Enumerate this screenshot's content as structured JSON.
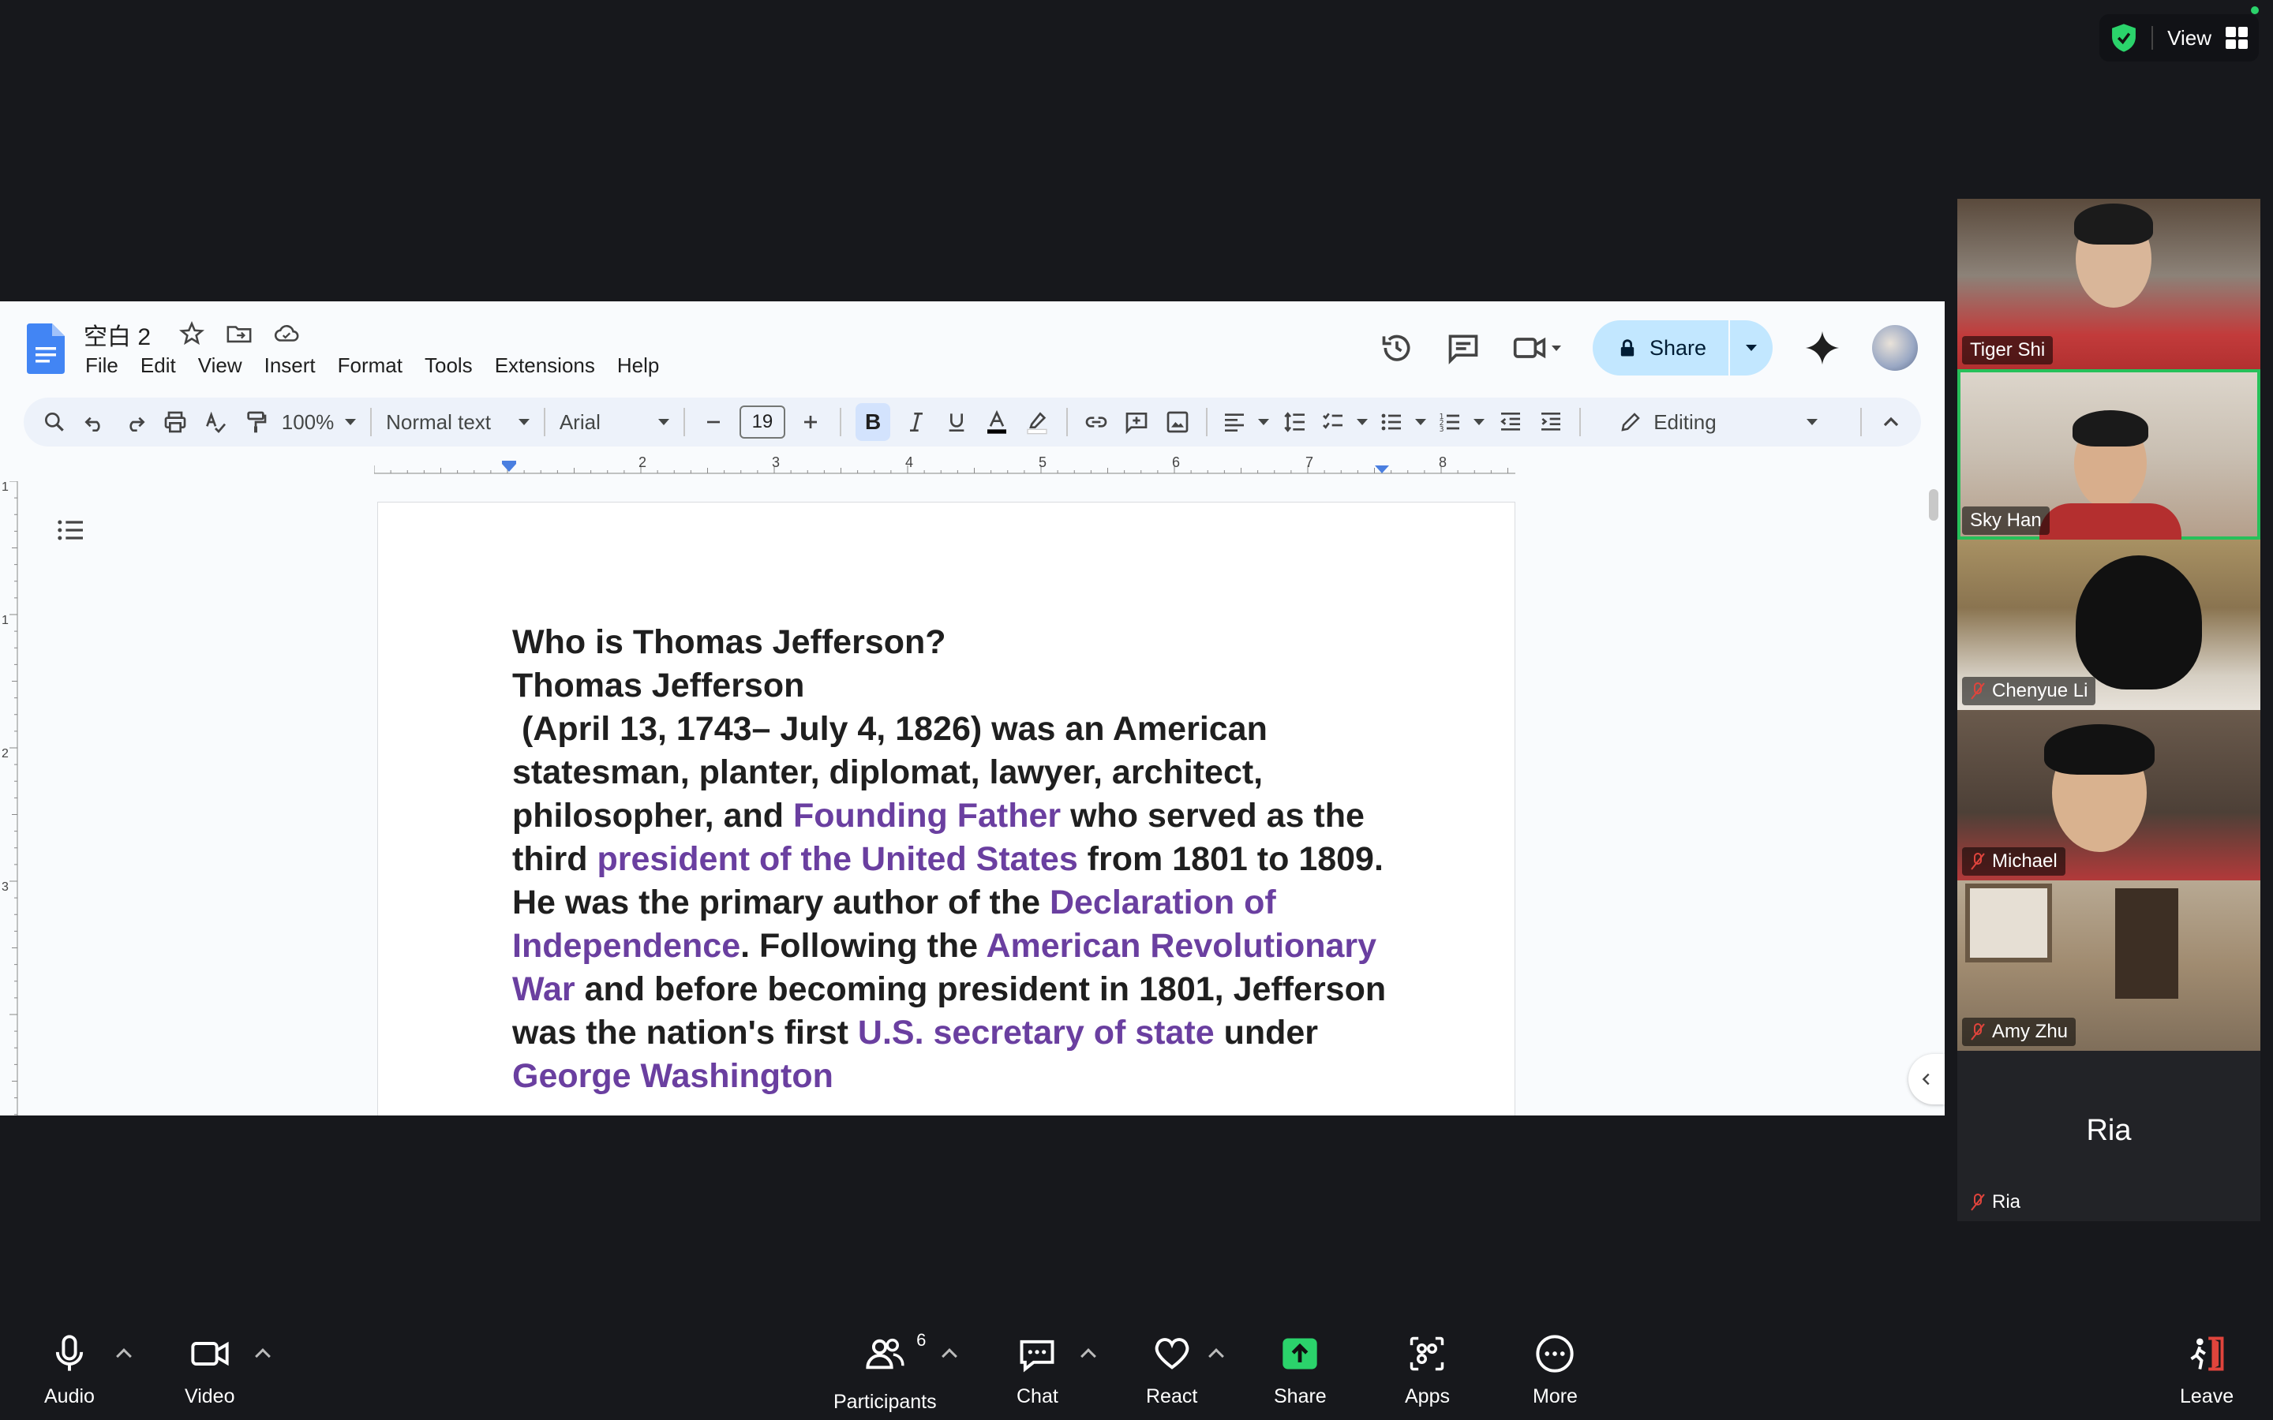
{
  "topbar": {
    "view_label": "View"
  },
  "doc": {
    "title": "空白 2",
    "menus": [
      "File",
      "Edit",
      "View",
      "Insert",
      "Format",
      "Tools",
      "Extensions",
      "Help"
    ],
    "share_label": "Share",
    "toolbar": {
      "zoom": "100%",
      "style": "Normal text",
      "font": "Arial",
      "font_size": "19",
      "bold": "B",
      "mode": "Editing"
    },
    "ruler_numbers": [
      "2",
      "3",
      "4",
      "5",
      "6",
      "7",
      "8"
    ],
    "vruler_numbers": [
      "1",
      "1",
      "2",
      "3"
    ],
    "content": {
      "heading1": "Who is Thomas Jefferson?",
      "heading2": "Thomas Jefferson",
      "p1": " (April 13, 1743– July 4, 1826) was an American statesman, planter, diplomat, lawyer, architect, philosopher, and ",
      "link1": "Founding Father",
      "p2": " who served as the third ",
      "link2": "president of the United States",
      "p3": " from 1801 to 1809. He was the primary author of the ",
      "link3": "Declaration of Independence",
      "p4": ". Following the ",
      "link4": "American Revolutionary War",
      "p5": " and before becoming president in 1801, Jefferson was the nation's first ",
      "link5": "U.S. secretary of state",
      "p6": " under ",
      "link6": "George Washington"
    }
  },
  "participants": [
    {
      "name": "Tiger Shi",
      "muted": false
    },
    {
      "name": "Sky Han",
      "muted": false,
      "active": true
    },
    {
      "name": "Chenyue Li",
      "muted": true
    },
    {
      "name": "Michael",
      "muted": true
    },
    {
      "name": "Amy Zhu",
      "muted": true
    },
    {
      "name": "Ria",
      "muted": true,
      "video_off": true
    }
  ],
  "bottombar": {
    "audio": "Audio",
    "video": "Video",
    "participants": "Participants",
    "participants_count": "6",
    "chat": "Chat",
    "react": "React",
    "share": "Share",
    "apps": "Apps",
    "more": "More",
    "leave": "Leave"
  },
  "colors": {
    "link": "#6a3fa0",
    "share_green": "#2bd36b",
    "active_border": "#27c05a",
    "share_btn_bg": "#c2e7ff"
  }
}
